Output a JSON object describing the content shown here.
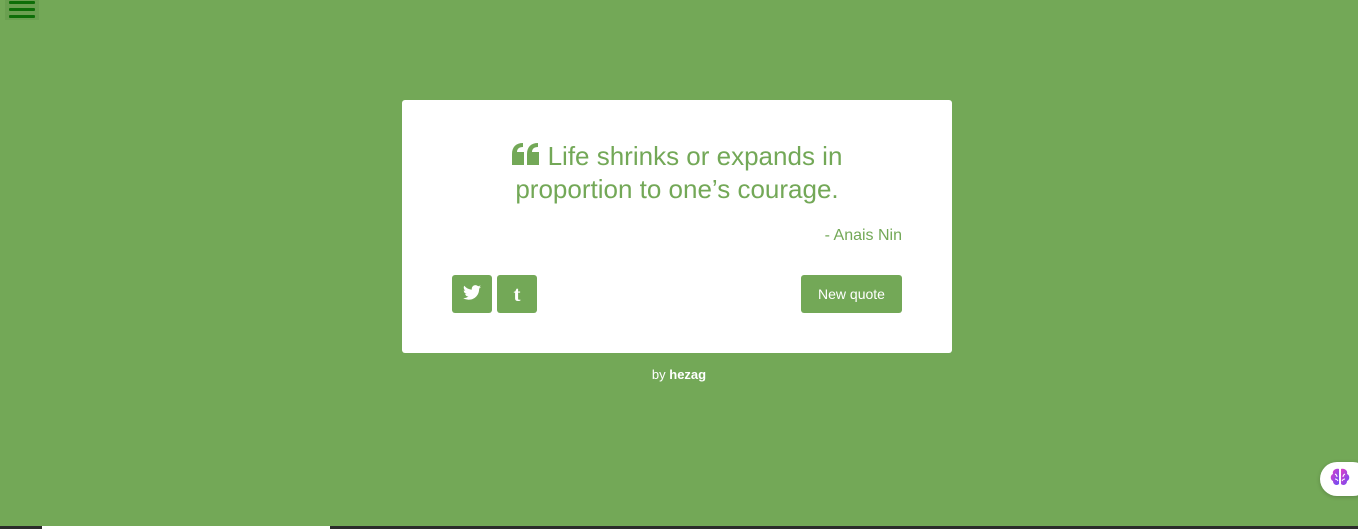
{
  "colors": {
    "background": "#73a857",
    "accent": "#73a857",
    "card": "#ffffff",
    "menu_bars": "#0d6e07"
  },
  "menu": {
    "icon": "hamburger-menu-icon"
  },
  "quote": {
    "icon": "quote-left-icon",
    "text": "Life shrinks or expands in proportion to one’s courage.",
    "author": "- Anais Nin"
  },
  "actions": {
    "twitter_icon": "twitter-icon",
    "tumblr_icon": "tumblr-icon",
    "tumblr_glyph": "t",
    "new_quote_label": "New quote"
  },
  "footer": {
    "prefix": "by",
    "author": "hezag"
  },
  "badge": {
    "icon": "brain-icon"
  }
}
